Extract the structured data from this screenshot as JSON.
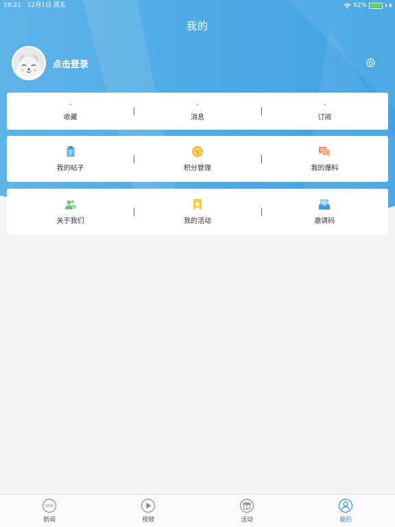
{
  "status_bar": {
    "time": "19:21",
    "date": "12月1日 周五",
    "battery": "92%",
    "battery_level": 0.92
  },
  "header": {
    "title": "我的"
  },
  "profile": {
    "login_text": "点击登录"
  },
  "stats": [
    {
      "value": "-",
      "label": "收藏"
    },
    {
      "value": "-",
      "label": "消息"
    },
    {
      "value": "-",
      "label": "订阅"
    }
  ],
  "menu_row1": [
    {
      "icon": "clipboard-icon",
      "label": "我的帖子"
    },
    {
      "icon": "coin-icon",
      "label": "积分管理"
    },
    {
      "icon": "chat-bubbles-icon",
      "label": "我的爆料"
    }
  ],
  "menu_row2": [
    {
      "icon": "users-icon",
      "label": "关于我们"
    },
    {
      "icon": "star-bookmark-icon",
      "label": "我的活动"
    },
    {
      "icon": "inbox-icon",
      "label": "邀请码"
    }
  ],
  "tabbar": [
    {
      "label": "新闻",
      "icon_text": "NEW",
      "active": false
    },
    {
      "label": "视频",
      "active": false
    },
    {
      "label": "活动",
      "active": false
    },
    {
      "label": "我的",
      "active": true
    }
  ],
  "colors": {
    "header": "#4aa6e2",
    "accent": "#2f8fd6",
    "battery": "#4cd964"
  }
}
